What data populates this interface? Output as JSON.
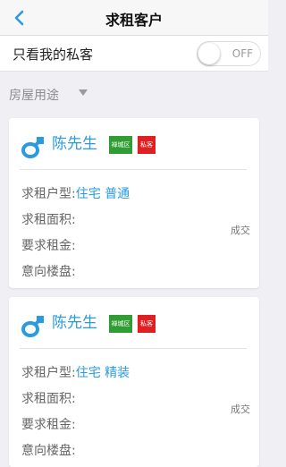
{
  "nav": {
    "title": "求租客户"
  },
  "toggle": {
    "label": "只看我的私客",
    "state_text": "OFF",
    "on": false
  },
  "filter": {
    "label": "房屋用途"
  },
  "list_label": {
    "type": "求租户型:",
    "area": "求租面积:",
    "rent": "要求租金:",
    "building": "意向楼盘:"
  },
  "customers": [
    {
      "name": "陈先生",
      "district_badge": "禅城区",
      "private_badge": "私客",
      "type_value": "住宅",
      "type_extra": "普通",
      "area_value": "",
      "rent_value": "",
      "building_value": "",
      "action": "成交"
    },
    {
      "name": "陈先生",
      "district_badge": "禅城区",
      "private_badge": "私客",
      "type_value": "住宅",
      "type_extra": "精装",
      "area_value": "",
      "rent_value": "",
      "building_value": "",
      "action": "成交"
    }
  ],
  "colors": {
    "accent": "#2b9be0",
    "district_badge": "#2f9c34",
    "private_badge": "#e02020"
  },
  "icons": {
    "back": "chevron-left-icon",
    "avatar": "male-symbol-icon"
  }
}
